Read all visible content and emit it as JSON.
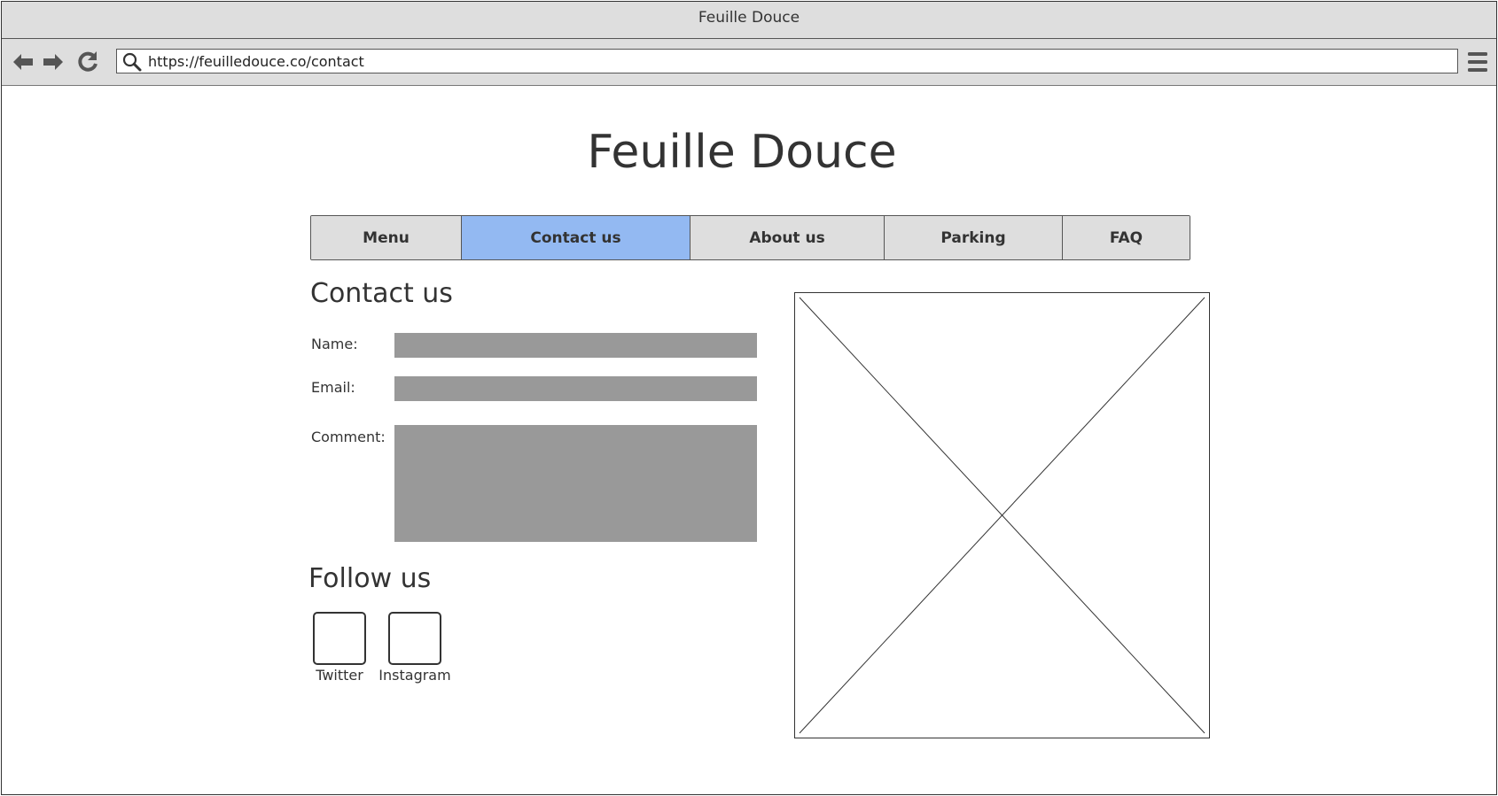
{
  "browser": {
    "window_title": "Feuille Douce",
    "url": "https://feuilledouce.co/contact",
    "icons": {
      "back": "arrow-left-icon",
      "forward": "arrow-right-icon",
      "reload": "reload-icon",
      "search": "search-icon",
      "menu": "hamburger-menu-icon"
    }
  },
  "site": {
    "title": "Feuille Douce"
  },
  "nav": {
    "tabs": [
      {
        "label": "Menu",
        "active": false
      },
      {
        "label": "Contact us",
        "active": true
      },
      {
        "label": "About us",
        "active": false
      },
      {
        "label": "Parking",
        "active": false
      },
      {
        "label": "FAQ",
        "active": false
      }
    ]
  },
  "contact": {
    "heading": "Contact us",
    "name_label": "Name:",
    "email_label": "Email:",
    "comment_label": "Comment:",
    "name_value": "",
    "email_value": "",
    "comment_value": ""
  },
  "follow": {
    "heading": "Follow us",
    "twitter_label": "Twitter",
    "instagram_label": "Instagram"
  },
  "colors": {
    "active_tab": "#93b9f2",
    "tab_background": "#dedede",
    "field_fill": "#999999",
    "chrome": "#dedede"
  }
}
